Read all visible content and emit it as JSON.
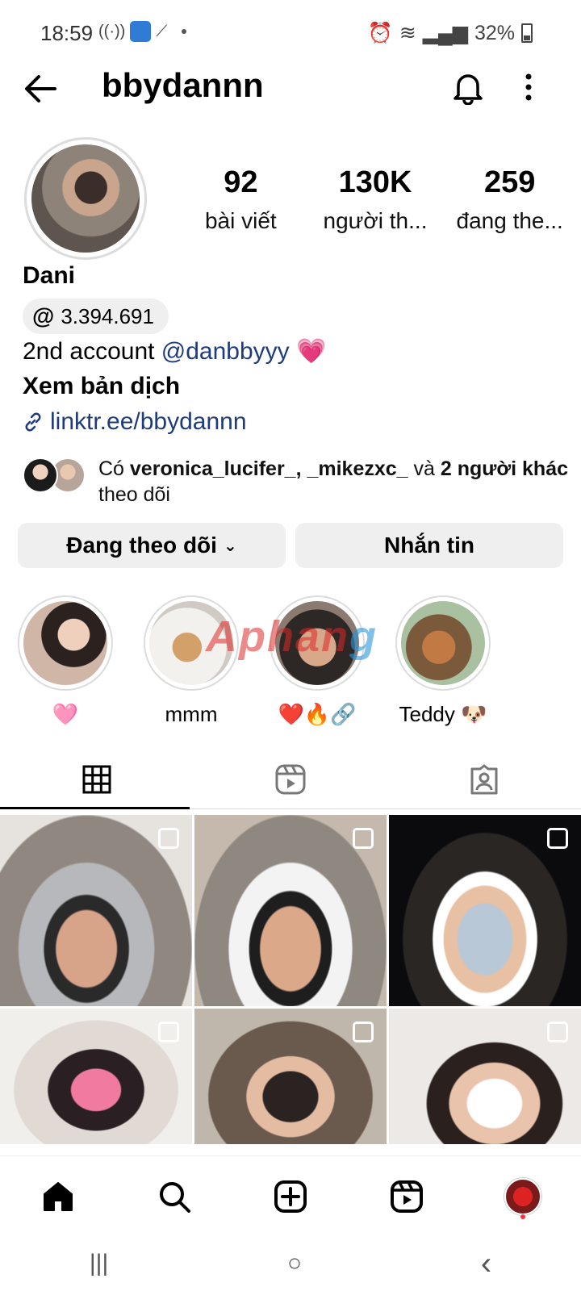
{
  "status_bar": {
    "time": "18:59",
    "battery": "32%"
  },
  "header": {
    "username": "bbydannn"
  },
  "profile": {
    "stats": [
      {
        "value": "92",
        "label": "bài viết"
      },
      {
        "value": "130K",
        "label": "người th..."
      },
      {
        "value": "259",
        "label": "đang the..."
      }
    ],
    "display_name": "Dani",
    "threads_count": "3.394.691",
    "bio_prefix": "2nd account ",
    "bio_mention": "@danbbyyy",
    "bio_emoji": "💗",
    "translate": "Xem bản dịch",
    "link": "linktr.ee/bbydannn",
    "followed_by": {
      "prefix": "Có ",
      "names": "veronica_lucifer_, _mikezxc_",
      "middle": " và ",
      "others": "2 người khác",
      "suffix": " theo dõi"
    }
  },
  "actions": {
    "following": "Đang theo dõi",
    "message": "Nhắn tin"
  },
  "highlights": [
    {
      "label": "🩷"
    },
    {
      "label": "mmm"
    },
    {
      "label": "❤️🔥🔗"
    },
    {
      "label": "Teddy 🐶"
    }
  ],
  "watermark": {
    "part1": "Aphan",
    "part2": "g"
  },
  "tabs": [
    {
      "icon": "grid-icon",
      "active": true
    },
    {
      "icon": "reels-icon",
      "active": false
    },
    {
      "icon": "tagged-icon",
      "active": false
    }
  ],
  "posts": [
    {
      "multi": true
    },
    {
      "multi": true
    },
    {
      "multi": true
    },
    {
      "multi": true
    },
    {
      "multi": true
    },
    {
      "multi": true
    }
  ],
  "bottom_nav": [
    "home-icon",
    "search-icon",
    "create-icon",
    "reels-icon",
    "profile-avatar"
  ],
  "system_nav": {
    "recents": "|||",
    "home": "○",
    "back": "‹"
  }
}
